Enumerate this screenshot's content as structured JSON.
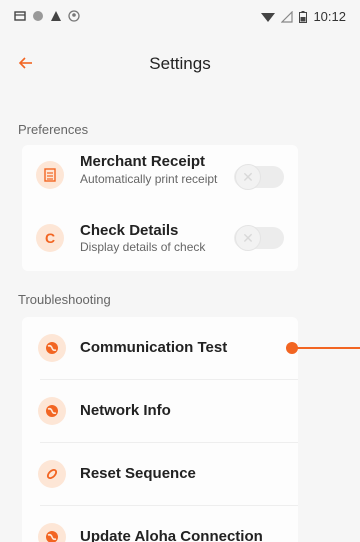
{
  "status_bar": {
    "time": "10:12",
    "icons": [
      "sim-icon",
      "circle-icon",
      "alert-icon",
      "account-icon",
      "wifi-icon",
      "signal-icon",
      "battery-icon"
    ]
  },
  "toolbar": {
    "title": "Settings",
    "back_icon": "arrow-left-icon"
  },
  "preferences": {
    "label": "Preferences",
    "items": [
      {
        "title": "Merchant Receipt",
        "subtitle": "Automatically print receipt",
        "icon": "receipt-icon",
        "enabled": false
      },
      {
        "title": "Check Details",
        "subtitle": "Display details of check",
        "icon": "check-c-icon",
        "icon_text": "C",
        "enabled": false
      }
    ]
  },
  "troubleshooting": {
    "label": "Troubleshooting",
    "items": [
      {
        "label": "Communication Test",
        "icon": "globe-icon"
      },
      {
        "label": "Network Info",
        "icon": "globe-icon"
      },
      {
        "label": "Reset Sequence",
        "icon": "reset-icon"
      },
      {
        "label": "Update Aloha Connection",
        "icon": "globe-icon"
      }
    ]
  },
  "colors": {
    "accent": "#f26522",
    "icon_bg": "#fde6d6",
    "background": "#f6f6f6"
  }
}
